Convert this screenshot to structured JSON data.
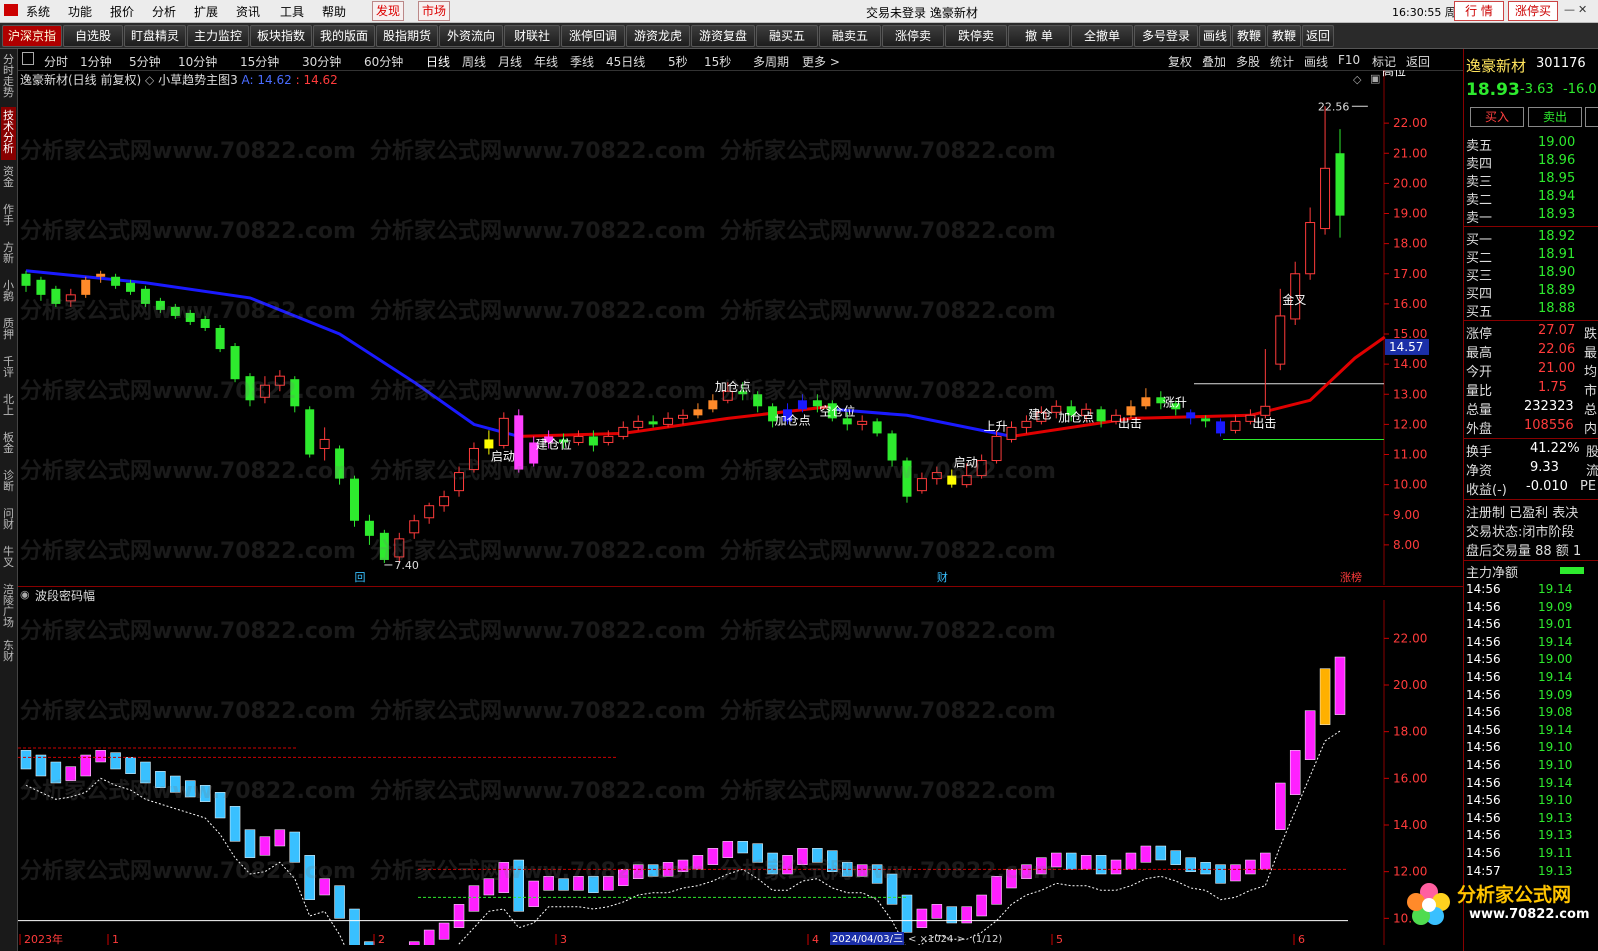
{
  "menu": {
    "items": [
      "系统",
      "功能",
      "报价",
      "分析",
      "扩展",
      "资讯",
      "工具",
      "帮助"
    ],
    "discover": "发现",
    "market": "市场",
    "center_title": "交易未登录   逸豪新材",
    "clock": "16:30:55 周一",
    "btn_quote": "行 情",
    "btn_limitup": "涨停买"
  },
  "toolbar": {
    "items": [
      "沪深京指",
      "自选股",
      "盯盘精灵",
      "主力监控",
      "板块指数",
      "我的版面",
      "股指期货",
      "外资流向",
      "财联社",
      "涨停回调",
      "游资龙虎",
      "游资复盘",
      "融买五",
      "融卖五",
      "涨停卖",
      "跌停卖",
      "撤 单",
      "全撤单",
      "多号登录",
      "画线",
      "教鞭A",
      "教鞭B",
      "返回"
    ]
  },
  "left_tabs": [
    {
      "label": "分时走势",
      "active": false
    },
    {
      "label": "技术分析",
      "active": true
    },
    {
      "label": "资金",
      "active": false
    },
    {
      "label": "作手",
      "active": false
    },
    {
      "label": "方新",
      "active": false
    },
    {
      "label": "小鹅",
      "active": false
    },
    {
      "label": "质押",
      "active": false
    },
    {
      "label": "千评",
      "active": false
    },
    {
      "label": "北上",
      "active": false
    },
    {
      "label": "板金",
      "active": false
    },
    {
      "label": "诊断",
      "active": false
    },
    {
      "label": "问财",
      "active": false
    },
    {
      "label": "牛叉",
      "active": false
    },
    {
      "label": "涪陵广场",
      "active": false
    },
    {
      "label": "东财",
      "active": false
    }
  ],
  "periods": [
    "分时",
    "1分钟",
    "5分钟",
    "10分钟",
    "15分钟",
    "30分钟",
    "60分钟",
    "日线",
    "周线",
    "月线",
    "年线",
    "季线",
    "45日线",
    "5秒",
    "15秒",
    "多周期",
    "更多 >"
  ],
  "selected_period": "日线",
  "right_period_items": [
    "复权",
    "叠加",
    "多股",
    "统计",
    "画线",
    "F10",
    "标记",
    "返回"
  ],
  "main_chart": {
    "title": "逸豪新材(日线 前复权)",
    "indicator": "小草趋势主图3",
    "a_label": "A: 14.62",
    "b_label": ": 14.62",
    "high_label": "高位",
    "max_price_label": "22.56",
    "min_price_label": "7.40",
    "current_price_box": "14.57",
    "y_ticks": [
      "22.00",
      "21.00",
      "20.00",
      "19.00",
      "18.00",
      "17.00",
      "16.00",
      "15.00",
      "14.00",
      "13.00",
      "12.00",
      "11.00",
      "10.00",
      "9.00",
      "8.00"
    ],
    "annotations": [
      "启动",
      "建仓位",
      "加仓点",
      "加仓点",
      "空仓位",
      "启动",
      "上升",
      "建仓",
      "加仓点",
      "出击",
      "涨升",
      "出击",
      "金叉"
    ],
    "markers": [
      "回",
      "财",
      "涨榜"
    ]
  },
  "sub_chart": {
    "title": "波段密码幅",
    "y_ticks": [
      "22.00",
      "20.00",
      "18.00",
      "16.00",
      "14.00",
      "12.00",
      "10.00"
    ]
  },
  "x_axis": {
    "labels": [
      "2023年",
      "1",
      "2",
      "3",
      "4",
      "5",
      "6"
    ],
    "date_box": "2024/04/03/三",
    "zoom": "1024",
    "page": "(1/12)"
  },
  "watermark": "分析家公式网www.70822.com",
  "chart_data": {
    "type": "candlestick",
    "title": "逸豪新材(日线 前复权)",
    "ylim": [
      7,
      23
    ],
    "candles": [
      {
        "o": 17.0,
        "c": 16.6,
        "h": 17.1,
        "l": 16.4
      },
      {
        "o": 16.8,
        "c": 16.3,
        "h": 16.9,
        "l": 16.1
      },
      {
        "o": 16.5,
        "c": 16.0,
        "h": 16.6,
        "l": 15.9
      },
      {
        "o": 16.1,
        "c": 16.3,
        "h": 16.5,
        "l": 15.9
      },
      {
        "o": 16.3,
        "c": 16.8,
        "h": 16.9,
        "l": 16.2
      },
      {
        "o": 16.9,
        "c": 17.0,
        "h": 17.1,
        "l": 16.7
      },
      {
        "o": 16.9,
        "c": 16.6,
        "h": 17.0,
        "l": 16.5
      },
      {
        "o": 16.7,
        "c": 16.4,
        "h": 16.8,
        "l": 16.3
      },
      {
        "o": 16.5,
        "c": 16.0,
        "h": 16.6,
        "l": 15.9
      },
      {
        "o": 16.1,
        "c": 15.8,
        "h": 16.2,
        "l": 15.7
      },
      {
        "o": 15.9,
        "c": 15.6,
        "h": 16.0,
        "l": 15.5
      },
      {
        "o": 15.7,
        "c": 15.4,
        "h": 15.8,
        "l": 15.3
      },
      {
        "o": 15.5,
        "c": 15.2,
        "h": 15.6,
        "l": 15.1
      },
      {
        "o": 15.2,
        "c": 14.5,
        "h": 15.3,
        "l": 14.4
      },
      {
        "o": 14.6,
        "c": 13.5,
        "h": 14.7,
        "l": 13.4
      },
      {
        "o": 13.6,
        "c": 12.8,
        "h": 13.7,
        "l": 12.6
      },
      {
        "o": 12.9,
        "c": 13.3,
        "h": 13.6,
        "l": 12.7
      },
      {
        "o": 13.3,
        "c": 13.6,
        "h": 13.8,
        "l": 13.1
      },
      {
        "o": 13.5,
        "c": 12.6,
        "h": 13.6,
        "l": 12.4
      },
      {
        "o": 12.5,
        "c": 11.0,
        "h": 12.6,
        "l": 10.9
      },
      {
        "o": 11.2,
        "c": 11.5,
        "h": 11.9,
        "l": 10.8
      },
      {
        "o": 11.2,
        "c": 10.2,
        "h": 11.3,
        "l": 10.0
      },
      {
        "o": 10.2,
        "c": 8.8,
        "h": 10.3,
        "l": 8.6
      },
      {
        "o": 8.8,
        "c": 8.3,
        "h": 9.0,
        "l": 8.0
      },
      {
        "o": 8.4,
        "c": 7.5,
        "h": 8.5,
        "l": 7.4
      },
      {
        "o": 7.6,
        "c": 8.2,
        "h": 8.4,
        "l": 7.4
      },
      {
        "o": 8.4,
        "c": 8.8,
        "h": 9.0,
        "l": 8.2
      },
      {
        "o": 8.9,
        "c": 9.3,
        "h": 9.4,
        "l": 8.7
      },
      {
        "o": 9.3,
        "c": 9.6,
        "h": 9.8,
        "l": 9.1
      },
      {
        "o": 9.8,
        "c": 10.4,
        "h": 10.6,
        "l": 9.6
      },
      {
        "o": 10.5,
        "c": 11.2,
        "h": 11.4,
        "l": 10.4
      },
      {
        "o": 11.2,
        "c": 11.5,
        "h": 11.8,
        "l": 11.0
      },
      {
        "o": 11.3,
        "c": 12.2,
        "h": 12.4,
        "l": 11.2
      },
      {
        "o": 12.3,
        "c": 10.5,
        "h": 12.5,
        "l": 10.4
      },
      {
        "o": 10.7,
        "c": 11.4,
        "h": 11.6,
        "l": 10.6
      },
      {
        "o": 11.4,
        "c": 11.6,
        "h": 11.8,
        "l": 11.2
      },
      {
        "o": 11.5,
        "c": 11.4,
        "h": 11.7,
        "l": 11.2
      },
      {
        "o": 11.4,
        "c": 11.6,
        "h": 11.8,
        "l": 11.3
      },
      {
        "o": 11.6,
        "c": 11.3,
        "h": 11.8,
        "l": 11.1
      },
      {
        "o": 11.4,
        "c": 11.6,
        "h": 11.8,
        "l": 11.3
      },
      {
        "o": 11.6,
        "c": 11.9,
        "h": 12.1,
        "l": 11.5
      },
      {
        "o": 11.9,
        "c": 12.1,
        "h": 12.3,
        "l": 11.8
      },
      {
        "o": 12.1,
        "c": 12.0,
        "h": 12.3,
        "l": 11.9
      },
      {
        "o": 12.0,
        "c": 12.2,
        "h": 12.4,
        "l": 11.9
      },
      {
        "o": 12.2,
        "c": 12.3,
        "h": 12.5,
        "l": 12.0
      },
      {
        "o": 12.3,
        "c": 12.5,
        "h": 12.7,
        "l": 12.2
      },
      {
        "o": 12.5,
        "c": 12.8,
        "h": 13.0,
        "l": 12.4
      },
      {
        "o": 12.8,
        "c": 13.1,
        "h": 13.4,
        "l": 12.7
      },
      {
        "o": 13.1,
        "c": 13.0,
        "h": 13.4,
        "l": 12.8
      },
      {
        "o": 13.0,
        "c": 12.6,
        "h": 13.1,
        "l": 12.4
      },
      {
        "o": 12.6,
        "c": 12.1,
        "h": 12.7,
        "l": 11.9
      },
      {
        "o": 12.1,
        "c": 12.5,
        "h": 12.7,
        "l": 12.0
      },
      {
        "o": 12.5,
        "c": 12.8,
        "h": 13.0,
        "l": 12.4
      },
      {
        "o": 12.8,
        "c": 12.6,
        "h": 13.0,
        "l": 12.4
      },
      {
        "o": 12.7,
        "c": 12.2,
        "h": 12.8,
        "l": 12.1
      },
      {
        "o": 12.2,
        "c": 12.0,
        "h": 12.4,
        "l": 11.8
      },
      {
        "o": 12.0,
        "c": 12.1,
        "h": 12.3,
        "l": 11.8
      },
      {
        "o": 12.1,
        "c": 11.7,
        "h": 12.2,
        "l": 11.6
      },
      {
        "o": 11.7,
        "c": 10.8,
        "h": 11.8,
        "l": 10.6
      },
      {
        "o": 10.8,
        "c": 9.6,
        "h": 10.9,
        "l": 9.4
      },
      {
        "o": 9.8,
        "c": 10.2,
        "h": 10.4,
        "l": 9.7
      },
      {
        "o": 10.2,
        "c": 10.4,
        "h": 10.6,
        "l": 10.0
      },
      {
        "o": 10.3,
        "c": 10.0,
        "h": 10.5,
        "l": 9.9
      },
      {
        "o": 10.0,
        "c": 10.3,
        "h": 10.7,
        "l": 9.9
      },
      {
        "o": 10.3,
        "c": 10.8,
        "h": 11.0,
        "l": 10.2
      },
      {
        "o": 10.8,
        "c": 11.6,
        "h": 11.8,
        "l": 10.7
      },
      {
        "o": 11.5,
        "c": 11.9,
        "h": 12.1,
        "l": 11.4
      },
      {
        "o": 11.9,
        "c": 12.1,
        "h": 12.3,
        "l": 11.7
      },
      {
        "o": 12.1,
        "c": 12.4,
        "h": 12.6,
        "l": 12.0
      },
      {
        "o": 12.4,
        "c": 12.6,
        "h": 12.8,
        "l": 12.2
      },
      {
        "o": 12.6,
        "c": 12.3,
        "h": 12.8,
        "l": 12.1
      },
      {
        "o": 12.3,
        "c": 12.5,
        "h": 12.7,
        "l": 12.1
      },
      {
        "o": 12.5,
        "c": 12.1,
        "h": 12.6,
        "l": 11.9
      },
      {
        "o": 12.1,
        "c": 12.3,
        "h": 12.5,
        "l": 12.0
      },
      {
        "o": 12.3,
        "c": 12.6,
        "h": 12.8,
        "l": 12.2
      },
      {
        "o": 12.6,
        "c": 12.9,
        "h": 13.2,
        "l": 12.5
      },
      {
        "o": 12.9,
        "c": 12.7,
        "h": 13.1,
        "l": 12.5
      },
      {
        "o": 12.7,
        "c": 12.5,
        "h": 12.8,
        "l": 12.3
      },
      {
        "o": 12.4,
        "c": 12.2,
        "h": 12.5,
        "l": 12.0
      },
      {
        "o": 12.2,
        "c": 12.1,
        "h": 12.3,
        "l": 11.9
      },
      {
        "o": 12.1,
        "c": 11.7,
        "h": 12.2,
        "l": 11.6
      },
      {
        "o": 11.8,
        "c": 12.1,
        "h": 12.3,
        "l": 11.7
      },
      {
        "o": 12.1,
        "c": 12.3,
        "h": 12.5,
        "l": 12.0
      },
      {
        "o": 12.3,
        "c": 12.6,
        "h": 14.5,
        "l": 12.2
      },
      {
        "o": 14.0,
        "c": 15.6,
        "h": 16.5,
        "l": 13.8
      },
      {
        "o": 15.5,
        "c": 17.0,
        "h": 17.4,
        "l": 15.3
      },
      {
        "o": 17.0,
        "c": 18.7,
        "h": 19.2,
        "l": 16.8
      },
      {
        "o": 18.5,
        "c": 20.5,
        "h": 22.56,
        "l": 18.3
      },
      {
        "o": 21.0,
        "c": 18.93,
        "h": 21.8,
        "l": 18.2
      }
    ],
    "ma_blue": [
      [
        0,
        17.1
      ],
      [
        8,
        16.7
      ],
      [
        15,
        16.2
      ],
      [
        21,
        15.0
      ],
      [
        26,
        13.4
      ],
      [
        30,
        12.0
      ],
      [
        33,
        11.6
      ]
    ],
    "ma_red": [
      [
        33,
        11.6
      ],
      [
        40,
        11.7
      ],
      [
        47,
        12.2
      ],
      [
        54,
        12.6
      ]
    ],
    "ma_blue2": [
      [
        54,
        12.5
      ],
      [
        59,
        12.3
      ],
      [
        66,
        11.6
      ]
    ],
    "ma_red2": [
      [
        66,
        11.6
      ],
      [
        74,
        12.2
      ],
      [
        82,
        12.3
      ],
      [
        86,
        12.8
      ],
      [
        89,
        14.2
      ],
      [
        91,
        14.9
      ]
    ]
  },
  "right_panel": {
    "stock_name": "逸豪新材",
    "stock_code": "301176",
    "price": "18.93",
    "change": "-3.63",
    "change_pct": "-16.0",
    "buy_btn": "买入",
    "sell_btn": "卖出",
    "asks": [
      {
        "label": "卖五",
        "price": "19.00"
      },
      {
        "label": "卖四",
        "price": "18.96"
      },
      {
        "label": "卖三",
        "price": "18.95"
      },
      {
        "label": "卖二",
        "price": "18.94"
      },
      {
        "label": "卖一",
        "price": "18.93"
      }
    ],
    "bids": [
      {
        "label": "买一",
        "price": "18.92"
      },
      {
        "label": "买二",
        "price": "18.91"
      },
      {
        "label": "买三",
        "price": "18.90"
      },
      {
        "label": "买四",
        "price": "18.89"
      },
      {
        "label": "买五",
        "price": "18.88"
      }
    ],
    "stats": [
      {
        "label": "涨停",
        "value": "27.07",
        "tail": "跌"
      },
      {
        "label": "最高",
        "value": "22.06",
        "tail": "最"
      },
      {
        "label": "今开",
        "value": "21.00",
        "tail": "均"
      },
      {
        "label": "量比",
        "value": "1.75",
        "tail": "市"
      },
      {
        "label": "总量",
        "value": "232323",
        "tail": "总"
      },
      {
        "label": "外盘",
        "value": "108556",
        "tail": "内"
      }
    ],
    "stats2": [
      {
        "label": "换手",
        "value": "41.22%",
        "tail": "股"
      },
      {
        "label": "净资",
        "value": "9.33",
        "tail": "流"
      },
      {
        "label": "收益(-)",
        "value": "-0.010",
        "tail": "PE"
      }
    ],
    "info_lines": [
      "注册制 已盈利 表决",
      "交易状态:闭市阶段",
      "盘后交易量 88 额 1"
    ],
    "main_flow": "主力净额",
    "ticks": [
      {
        "t": "14:56",
        "p": "19.14"
      },
      {
        "t": "14:56",
        "p": "19.09"
      },
      {
        "t": "14:56",
        "p": "19.01"
      },
      {
        "t": "14:56",
        "p": "19.14"
      },
      {
        "t": "14:56",
        "p": "19.00"
      },
      {
        "t": "14:56",
        "p": "19.14"
      },
      {
        "t": "14:56",
        "p": "19.09"
      },
      {
        "t": "14:56",
        "p": "19.08"
      },
      {
        "t": "14:56",
        "p": "19.14"
      },
      {
        "t": "14:56",
        "p": "19.10"
      },
      {
        "t": "14:56",
        "p": "19.10"
      },
      {
        "t": "14:56",
        "p": "19.14"
      },
      {
        "t": "14:56",
        "p": "19.10"
      },
      {
        "t": "14:56",
        "p": "19.13"
      },
      {
        "t": "14:56",
        "p": "19.13"
      },
      {
        "t": "14:56",
        "p": "19.11"
      },
      {
        "t": "14:57",
        "p": "19.13"
      }
    ],
    "logo_text": "分析家公式网",
    "logo_url": "www.70822.com"
  }
}
